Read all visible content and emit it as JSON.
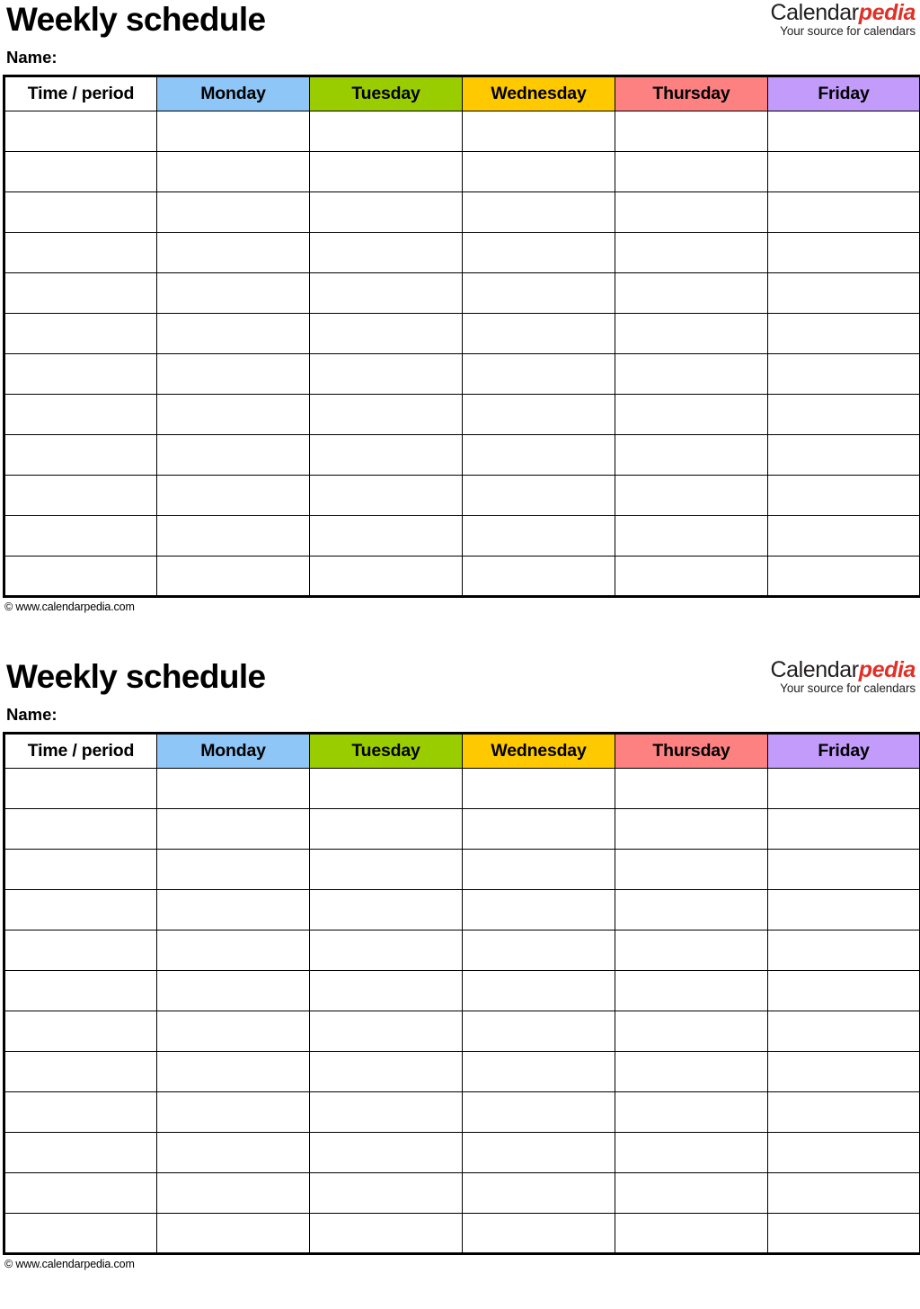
{
  "page": {
    "background": "#ffffff",
    "blocks": [
      {
        "title": "Weekly schedule",
        "name_label": "Name:",
        "brand": {
          "part1": "Calendar",
          "part2": "pedia",
          "tagline": "Your source for calendars"
        },
        "table": {
          "headers": [
            {
              "label": "Time / period",
              "color": "#ffffff"
            },
            {
              "label": "Monday",
              "color": "#8dc6f7"
            },
            {
              "label": "Tuesday",
              "color": "#9acd00"
            },
            {
              "label": "Wednesday",
              "color": "#ffc900"
            },
            {
              "label": "Thursday",
              "color": "#fc8180"
            },
            {
              "label": "Friday",
              "color": "#c29bfb"
            }
          ],
          "row_count": 12,
          "rows": [
            [
              "",
              "",
              "",
              "",
              "",
              ""
            ],
            [
              "",
              "",
              "",
              "",
              "",
              ""
            ],
            [
              "",
              "",
              "",
              "",
              "",
              ""
            ],
            [
              "",
              "",
              "",
              "",
              "",
              ""
            ],
            [
              "",
              "",
              "",
              "",
              "",
              ""
            ],
            [
              "",
              "",
              "",
              "",
              "",
              ""
            ],
            [
              "",
              "",
              "",
              "",
              "",
              ""
            ],
            [
              "",
              "",
              "",
              "",
              "",
              ""
            ],
            [
              "",
              "",
              "",
              "",
              "",
              ""
            ],
            [
              "",
              "",
              "",
              "",
              "",
              ""
            ],
            [
              "",
              "",
              "",
              "",
              "",
              ""
            ],
            [
              "",
              "",
              "",
              "",
              "",
              ""
            ]
          ]
        },
        "footer": "© www.calendarpedia.com"
      },
      {
        "title": "Weekly schedule",
        "name_label": "Name:",
        "brand": {
          "part1": "Calendar",
          "part2": "pedia",
          "tagline": "Your source for calendars"
        },
        "table": {
          "headers": [
            {
              "label": "Time / period",
              "color": "#ffffff"
            },
            {
              "label": "Monday",
              "color": "#8dc6f7"
            },
            {
              "label": "Tuesday",
              "color": "#9acd00"
            },
            {
              "label": "Wednesday",
              "color": "#ffc900"
            },
            {
              "label": "Thursday",
              "color": "#fc8180"
            },
            {
              "label": "Friday",
              "color": "#c29bfb"
            }
          ],
          "row_count": 12,
          "rows": [
            [
              "",
              "",
              "",
              "",
              "",
              ""
            ],
            [
              "",
              "",
              "",
              "",
              "",
              ""
            ],
            [
              "",
              "",
              "",
              "",
              "",
              ""
            ],
            [
              "",
              "",
              "",
              "",
              "",
              ""
            ],
            [
              "",
              "",
              "",
              "",
              "",
              ""
            ],
            [
              "",
              "",
              "",
              "",
              "",
              ""
            ],
            [
              "",
              "",
              "",
              "",
              "",
              ""
            ],
            [
              "",
              "",
              "",
              "",
              "",
              ""
            ],
            [
              "",
              "",
              "",
              "",
              "",
              ""
            ],
            [
              "",
              "",
              "",
              "",
              "",
              ""
            ],
            [
              "",
              "",
              "",
              "",
              "",
              ""
            ],
            [
              "",
              "",
              "",
              "",
              "",
              ""
            ]
          ]
        },
        "footer": "© www.calendarpedia.com"
      }
    ]
  }
}
